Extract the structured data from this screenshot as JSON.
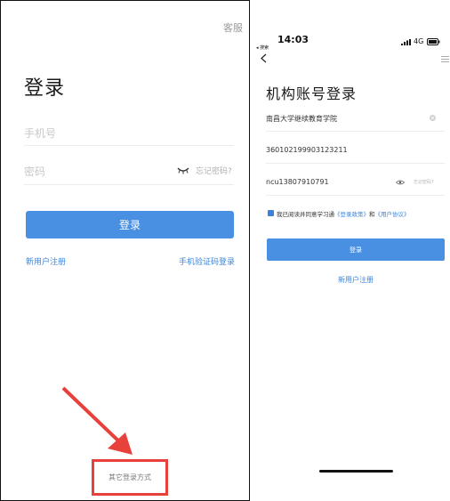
{
  "left": {
    "customer_service": "客服",
    "title": "登录",
    "phone_placeholder": "手机号",
    "password_placeholder": "密码",
    "forgot_password": "忘记密码?",
    "login_button": "登录",
    "register": "新用户注册",
    "sms_login": "手机验证码登录",
    "other_login": "其它登录方式"
  },
  "right": {
    "status": {
      "time": "14:03",
      "back_app": "◂ 搜索",
      "network": "4G"
    },
    "title": "机构账号登录",
    "school_value": "南昌大学继续教育学院",
    "id_value": "360102199903123211",
    "password_value": "ncu13807910791",
    "forgot_password": "忘记密码?",
    "agreement": {
      "prefix": "我已阅读并同意学习通",
      "policy": "《登录政策》",
      "and": "和",
      "terms": "《用户协议》"
    },
    "login_button": "登录",
    "register": "新用户注册"
  },
  "colors": {
    "accent": "#4a90e2",
    "link": "#3f85d8",
    "highlight": "#e8403b"
  },
  "icons": [
    "eye-closed-icon",
    "arrow-icon",
    "signal-icon",
    "battery-icon",
    "back-icon",
    "menu-icon",
    "clear-icon",
    "eye-open-icon",
    "checkbox-icon"
  ]
}
